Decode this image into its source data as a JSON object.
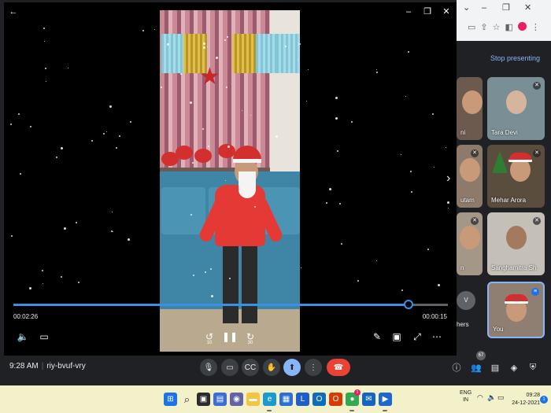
{
  "chrome": {
    "minimize": "–",
    "restore": "❐",
    "close": "✕",
    "chevron": "⌄"
  },
  "meet": {
    "stop_presenting": "Stop presenting",
    "participants": [
      {
        "name": "ni",
        "cut": true
      },
      {
        "name": "Tara Devi",
        "cut": false
      },
      {
        "name": "utam",
        "cut": true
      },
      {
        "name": "Mehar Arora",
        "cut": false
      },
      {
        "name": "n",
        "cut": true
      },
      {
        "name": "Sanghamitra Sh",
        "cut": false
      },
      {
        "name": "You",
        "cut": false,
        "me": true
      }
    ],
    "others_initial": "V",
    "others_label": "hers",
    "time": "9:28 AM",
    "meeting_code": "riy-bvuf-vry",
    "people_count": "67",
    "icons": {
      "mic": "mic-icon",
      "camera": "camera-icon",
      "captions": "captions-icon",
      "hand": "raise-hand-icon",
      "present": "present-icon",
      "more": "more-icon",
      "end": "end-call-icon",
      "info": "info-icon",
      "people": "people-icon",
      "chat": "chat-icon",
      "activities": "activities-icon",
      "host": "host-controls-icon"
    }
  },
  "player": {
    "back": "←",
    "current_time": "00:02:26",
    "remaining_time": "00:00:15",
    "progress_percent": 91,
    "skip_back_label": "10",
    "skip_forward_label": "30",
    "pause": "❚❚",
    "volume": "🔈",
    "subtitles": "▭",
    "edit": "✎",
    "miniview": "▣",
    "fullscreen": "⤢",
    "more": "⋯",
    "next": "›"
  },
  "taskbar": {
    "language_top": "ENG",
    "language_bottom": "IN",
    "clock_time": "09:28",
    "clock_date": "24-12-2021",
    "notification_count": "1",
    "chrome_badge": "1",
    "apps": [
      {
        "icon": "windows-start-icon",
        "color": "#1a73e8",
        "glyph": "⊞"
      },
      {
        "icon": "search-icon",
        "color": "#f3f1c9",
        "glyph": "⌕"
      },
      {
        "icon": "task-view-icon",
        "color": "#2b2b2b",
        "glyph": "▣"
      },
      {
        "icon": "widgets-icon",
        "color": "#3b6fd8",
        "glyph": "▤"
      },
      {
        "icon": "teams-chat-icon",
        "color": "#6264a7",
        "glyph": "◉"
      },
      {
        "icon": "file-explorer-icon",
        "color": "#f4c542",
        "glyph": "▬"
      },
      {
        "icon": "edge-icon",
        "color": "#1b9ad1",
        "glyph": "e"
      },
      {
        "icon": "store-icon",
        "color": "#2f6fd1",
        "glyph": "▦"
      },
      {
        "icon": "l-app-icon",
        "color": "#1f5fc9",
        "glyph": "L"
      },
      {
        "icon": "outlook-icon",
        "color": "#0f6cbd",
        "glyph": "O"
      },
      {
        "icon": "office-icon",
        "color": "#d83b01",
        "glyph": "O"
      },
      {
        "icon": "chrome-icon",
        "color": "#34a853",
        "glyph": "●"
      },
      {
        "icon": "mail-icon",
        "color": "#1565c0",
        "glyph": "✉"
      },
      {
        "icon": "media-player-icon",
        "color": "#1e66d0",
        "glyph": "▶"
      }
    ]
  },
  "colors": {
    "accent_blue": "#3d8ee6",
    "meet_blue": "#8ab4f8",
    "end_red": "#ea4335",
    "taskbar_bg": "#f3f1c9"
  }
}
